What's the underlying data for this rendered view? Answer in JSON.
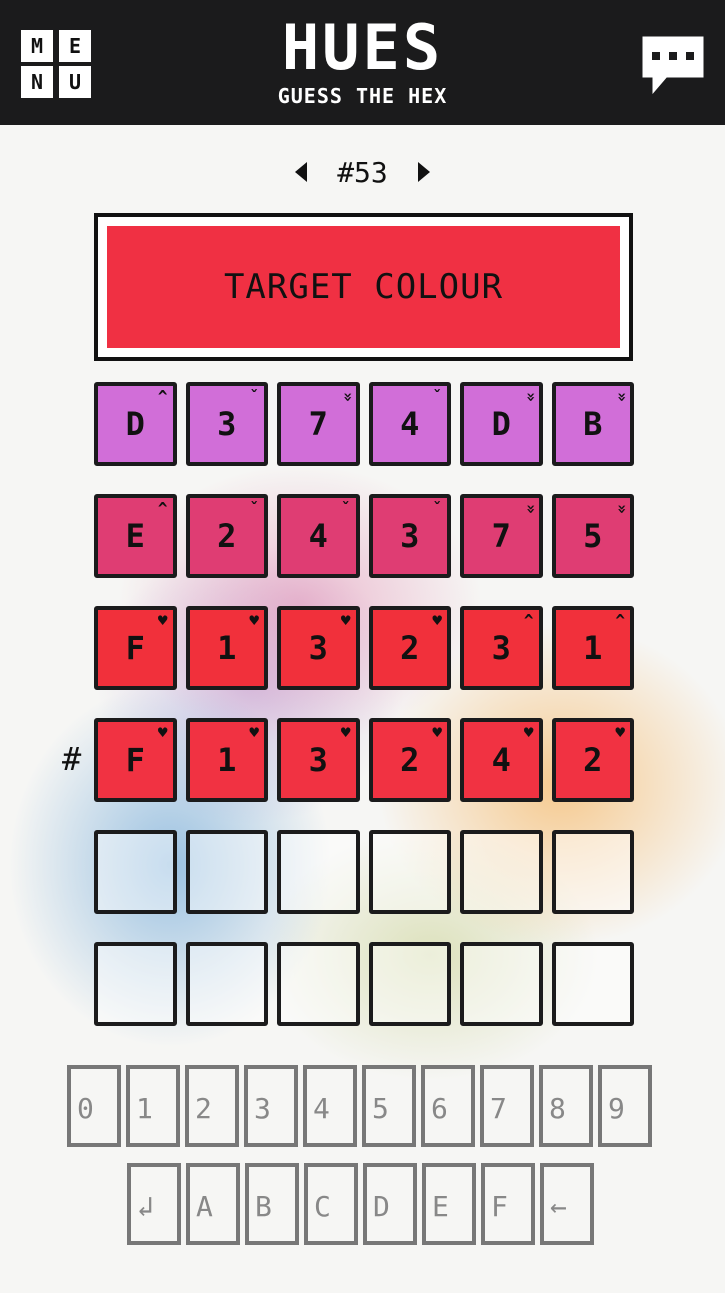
{
  "header": {
    "menu_letters": [
      "M",
      "E",
      "N",
      "U"
    ],
    "title": "HUES",
    "subtitle": "GUESS THE HEX"
  },
  "puzzle": {
    "number": "#53"
  },
  "target": {
    "label": "TARGET COLOUR",
    "color": "#f03043"
  },
  "prefix": "#",
  "guesses": [
    {
      "color": "#d16ed8",
      "tiles": [
        {
          "ch": "D",
          "hint": "^"
        },
        {
          "ch": "3",
          "hint": "ˇ"
        },
        {
          "ch": "7",
          "hint": "»"
        },
        {
          "ch": "4",
          "hint": "ˇ"
        },
        {
          "ch": "D",
          "hint": "»"
        },
        {
          "ch": "B",
          "hint": "»"
        }
      ]
    },
    {
      "color": "#df3d73",
      "tiles": [
        {
          "ch": "E",
          "hint": "^"
        },
        {
          "ch": "2",
          "hint": "ˇ"
        },
        {
          "ch": "4",
          "hint": "ˇ"
        },
        {
          "ch": "3",
          "hint": "ˇ"
        },
        {
          "ch": "7",
          "hint": "»"
        },
        {
          "ch": "5",
          "hint": "»"
        }
      ]
    },
    {
      "color": "#f1303b",
      "tiles": [
        {
          "ch": "F",
          "hint": "♥"
        },
        {
          "ch": "1",
          "hint": "♥"
        },
        {
          "ch": "3",
          "hint": "♥"
        },
        {
          "ch": "2",
          "hint": "♥"
        },
        {
          "ch": "3",
          "hint": "^"
        },
        {
          "ch": "1",
          "hint": "^"
        }
      ]
    },
    {
      "color": "#f13242",
      "tiles": [
        {
          "ch": "F",
          "hint": "♥"
        },
        {
          "ch": "1",
          "hint": "♥"
        },
        {
          "ch": "3",
          "hint": "♥"
        },
        {
          "ch": "2",
          "hint": "♥"
        },
        {
          "ch": "4",
          "hint": "♥"
        },
        {
          "ch": "2",
          "hint": "♥"
        }
      ]
    }
  ],
  "empty_rows": 2,
  "keyboard": {
    "row1": [
      "0",
      "1",
      "2",
      "3",
      "4",
      "5",
      "6",
      "7",
      "8",
      "9"
    ],
    "row2": [
      "↲",
      "A",
      "B",
      "C",
      "D",
      "E",
      "F",
      "←"
    ]
  },
  "icons": {
    "menu": "menu-icon",
    "chat": "speech-bubble-icon",
    "prev": "triangle-left-icon",
    "next": "triangle-right-icon"
  }
}
